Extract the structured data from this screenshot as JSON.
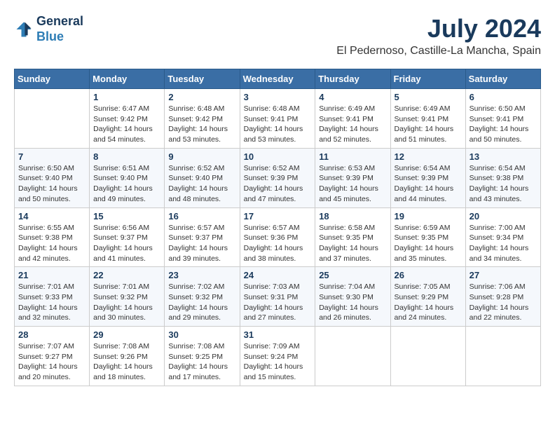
{
  "logo": {
    "text_general": "General",
    "text_blue": "Blue"
  },
  "title": "July 2024",
  "subtitle": "El Pedernoso, Castille-La Mancha, Spain",
  "days_of_week": [
    "Sunday",
    "Monday",
    "Tuesday",
    "Wednesday",
    "Thursday",
    "Friday",
    "Saturday"
  ],
  "weeks": [
    [
      {
        "day": "",
        "sunrise": "",
        "sunset": "",
        "daylight": ""
      },
      {
        "day": "1",
        "sunrise": "Sunrise: 6:47 AM",
        "sunset": "Sunset: 9:42 PM",
        "daylight": "Daylight: 14 hours and 54 minutes."
      },
      {
        "day": "2",
        "sunrise": "Sunrise: 6:48 AM",
        "sunset": "Sunset: 9:42 PM",
        "daylight": "Daylight: 14 hours and 53 minutes."
      },
      {
        "day": "3",
        "sunrise": "Sunrise: 6:48 AM",
        "sunset": "Sunset: 9:41 PM",
        "daylight": "Daylight: 14 hours and 53 minutes."
      },
      {
        "day": "4",
        "sunrise": "Sunrise: 6:49 AM",
        "sunset": "Sunset: 9:41 PM",
        "daylight": "Daylight: 14 hours and 52 minutes."
      },
      {
        "day": "5",
        "sunrise": "Sunrise: 6:49 AM",
        "sunset": "Sunset: 9:41 PM",
        "daylight": "Daylight: 14 hours and 51 minutes."
      },
      {
        "day": "6",
        "sunrise": "Sunrise: 6:50 AM",
        "sunset": "Sunset: 9:41 PM",
        "daylight": "Daylight: 14 hours and 50 minutes."
      }
    ],
    [
      {
        "day": "7",
        "sunrise": "Sunrise: 6:50 AM",
        "sunset": "Sunset: 9:40 PM",
        "daylight": "Daylight: 14 hours and 50 minutes."
      },
      {
        "day": "8",
        "sunrise": "Sunrise: 6:51 AM",
        "sunset": "Sunset: 9:40 PM",
        "daylight": "Daylight: 14 hours and 49 minutes."
      },
      {
        "day": "9",
        "sunrise": "Sunrise: 6:52 AM",
        "sunset": "Sunset: 9:40 PM",
        "daylight": "Daylight: 14 hours and 48 minutes."
      },
      {
        "day": "10",
        "sunrise": "Sunrise: 6:52 AM",
        "sunset": "Sunset: 9:39 PM",
        "daylight": "Daylight: 14 hours and 47 minutes."
      },
      {
        "day": "11",
        "sunrise": "Sunrise: 6:53 AM",
        "sunset": "Sunset: 9:39 PM",
        "daylight": "Daylight: 14 hours and 45 minutes."
      },
      {
        "day": "12",
        "sunrise": "Sunrise: 6:54 AM",
        "sunset": "Sunset: 9:39 PM",
        "daylight": "Daylight: 14 hours and 44 minutes."
      },
      {
        "day": "13",
        "sunrise": "Sunrise: 6:54 AM",
        "sunset": "Sunset: 9:38 PM",
        "daylight": "Daylight: 14 hours and 43 minutes."
      }
    ],
    [
      {
        "day": "14",
        "sunrise": "Sunrise: 6:55 AM",
        "sunset": "Sunset: 9:38 PM",
        "daylight": "Daylight: 14 hours and 42 minutes."
      },
      {
        "day": "15",
        "sunrise": "Sunrise: 6:56 AM",
        "sunset": "Sunset: 9:37 PM",
        "daylight": "Daylight: 14 hours and 41 minutes."
      },
      {
        "day": "16",
        "sunrise": "Sunrise: 6:57 AM",
        "sunset": "Sunset: 9:37 PM",
        "daylight": "Daylight: 14 hours and 39 minutes."
      },
      {
        "day": "17",
        "sunrise": "Sunrise: 6:57 AM",
        "sunset": "Sunset: 9:36 PM",
        "daylight": "Daylight: 14 hours and 38 minutes."
      },
      {
        "day": "18",
        "sunrise": "Sunrise: 6:58 AM",
        "sunset": "Sunset: 9:35 PM",
        "daylight": "Daylight: 14 hours and 37 minutes."
      },
      {
        "day": "19",
        "sunrise": "Sunrise: 6:59 AM",
        "sunset": "Sunset: 9:35 PM",
        "daylight": "Daylight: 14 hours and 35 minutes."
      },
      {
        "day": "20",
        "sunrise": "Sunrise: 7:00 AM",
        "sunset": "Sunset: 9:34 PM",
        "daylight": "Daylight: 14 hours and 34 minutes."
      }
    ],
    [
      {
        "day": "21",
        "sunrise": "Sunrise: 7:01 AM",
        "sunset": "Sunset: 9:33 PM",
        "daylight": "Daylight: 14 hours and 32 minutes."
      },
      {
        "day": "22",
        "sunrise": "Sunrise: 7:01 AM",
        "sunset": "Sunset: 9:32 PM",
        "daylight": "Daylight: 14 hours and 30 minutes."
      },
      {
        "day": "23",
        "sunrise": "Sunrise: 7:02 AM",
        "sunset": "Sunset: 9:32 PM",
        "daylight": "Daylight: 14 hours and 29 minutes."
      },
      {
        "day": "24",
        "sunrise": "Sunrise: 7:03 AM",
        "sunset": "Sunset: 9:31 PM",
        "daylight": "Daylight: 14 hours and 27 minutes."
      },
      {
        "day": "25",
        "sunrise": "Sunrise: 7:04 AM",
        "sunset": "Sunset: 9:30 PM",
        "daylight": "Daylight: 14 hours and 26 minutes."
      },
      {
        "day": "26",
        "sunrise": "Sunrise: 7:05 AM",
        "sunset": "Sunset: 9:29 PM",
        "daylight": "Daylight: 14 hours and 24 minutes."
      },
      {
        "day": "27",
        "sunrise": "Sunrise: 7:06 AM",
        "sunset": "Sunset: 9:28 PM",
        "daylight": "Daylight: 14 hours and 22 minutes."
      }
    ],
    [
      {
        "day": "28",
        "sunrise": "Sunrise: 7:07 AM",
        "sunset": "Sunset: 9:27 PM",
        "daylight": "Daylight: 14 hours and 20 minutes."
      },
      {
        "day": "29",
        "sunrise": "Sunrise: 7:08 AM",
        "sunset": "Sunset: 9:26 PM",
        "daylight": "Daylight: 14 hours and 18 minutes."
      },
      {
        "day": "30",
        "sunrise": "Sunrise: 7:08 AM",
        "sunset": "Sunset: 9:25 PM",
        "daylight": "Daylight: 14 hours and 17 minutes."
      },
      {
        "day": "31",
        "sunrise": "Sunrise: 7:09 AM",
        "sunset": "Sunset: 9:24 PM",
        "daylight": "Daylight: 14 hours and 15 minutes."
      },
      {
        "day": "",
        "sunrise": "",
        "sunset": "",
        "daylight": ""
      },
      {
        "day": "",
        "sunrise": "",
        "sunset": "",
        "daylight": ""
      },
      {
        "day": "",
        "sunrise": "",
        "sunset": "",
        "daylight": ""
      }
    ]
  ]
}
